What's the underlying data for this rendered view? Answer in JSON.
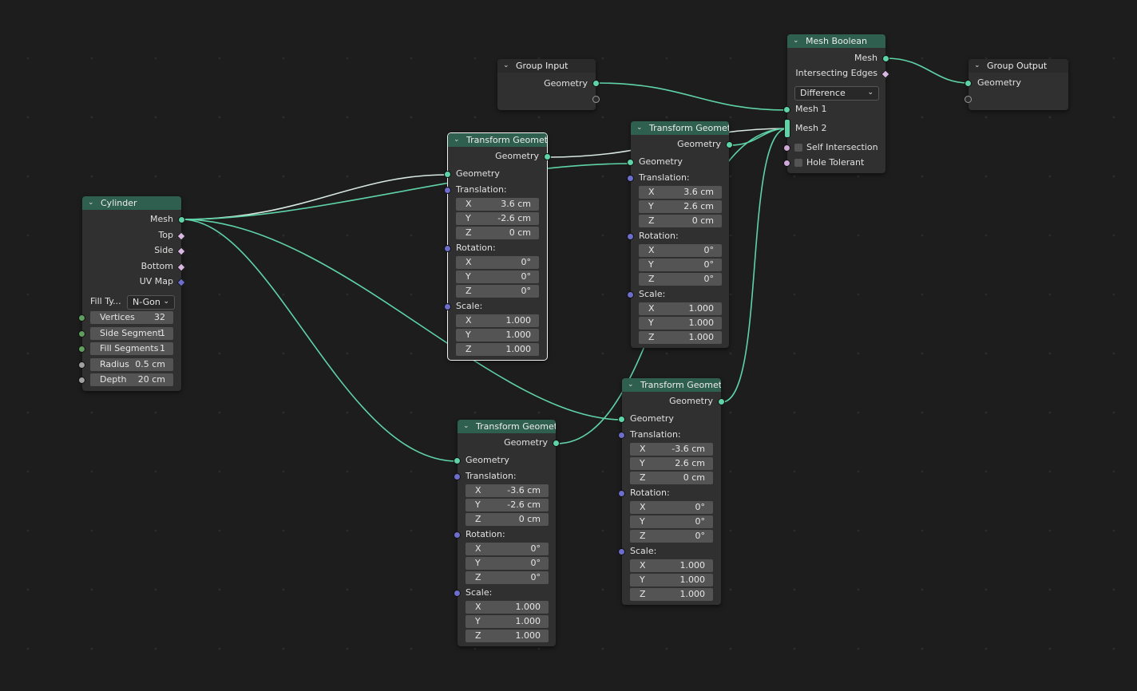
{
  "nodes": {
    "group_input": {
      "title": "Group Input",
      "out_geometry": "Geometry"
    },
    "group_output": {
      "title": "Group Output",
      "in_geometry": "Geometry"
    },
    "mesh_boolean": {
      "title": "Mesh Boolean",
      "out_mesh": "Mesh",
      "out_intersecting_edges": "Intersecting Edges",
      "operation": "Difference",
      "in_mesh1": "Mesh 1",
      "in_mesh2": "Mesh 2",
      "self_intersection": "Self Intersection",
      "hole_tolerant": "Hole Tolerant"
    },
    "cylinder": {
      "title": "Cylinder",
      "out_mesh": "Mesh",
      "out_top": "Top",
      "out_side": "Side",
      "out_bottom": "Bottom",
      "out_uv_map": "UV Map",
      "fill_type_label": "Fill Ty...",
      "fill_type_value": "N-Gon",
      "vertices_label": "Vertices",
      "vertices": "32",
      "side_segments_label": "Side Segment",
      "side_segments": "1",
      "fill_segments_label": "Fill Segments",
      "fill_segments": "1",
      "radius_label": "Radius",
      "radius": "0.5 cm",
      "depth_label": "Depth",
      "depth": "20 cm"
    },
    "transforms": [
      {
        "title": "Transform Geometry",
        "out": "Geometry",
        "in": "Geometry",
        "translation_label": "Translation:",
        "rotation_label": "Rotation:",
        "scale_label": "Scale:",
        "axes": [
          "X",
          "Y",
          "Z"
        ],
        "translation": [
          "3.6 cm",
          "-2.6 cm",
          "0 cm"
        ],
        "rotation": [
          "0°",
          "0°",
          "0°"
        ],
        "scale": [
          "1.000",
          "1.000",
          "1.000"
        ]
      },
      {
        "title": "Transform Geometry",
        "out": "Geometry",
        "in": "Geometry",
        "translation_label": "Translation:",
        "rotation_label": "Rotation:",
        "scale_label": "Scale:",
        "axes": [
          "X",
          "Y",
          "Z"
        ],
        "translation": [
          "3.6 cm",
          "2.6 cm",
          "0 cm"
        ],
        "rotation": [
          "0°",
          "0°",
          "0°"
        ],
        "scale": [
          "1.000",
          "1.000",
          "1.000"
        ]
      },
      {
        "title": "Transform Geometry",
        "out": "Geometry",
        "in": "Geometry",
        "translation_label": "Translation:",
        "rotation_label": "Rotation:",
        "scale_label": "Scale:",
        "axes": [
          "X",
          "Y",
          "Z"
        ],
        "translation": [
          "-3.6 cm",
          "-2.6 cm",
          "0 cm"
        ],
        "rotation": [
          "0°",
          "0°",
          "0°"
        ],
        "scale": [
          "1.000",
          "1.000",
          "1.000"
        ]
      },
      {
        "title": "Transform Geometry",
        "out": "Geometry",
        "in": "Geometry",
        "translation_label": "Translation:",
        "rotation_label": "Rotation:",
        "scale_label": "Scale:",
        "axes": [
          "X",
          "Y",
          "Z"
        ],
        "translation": [
          "-3.6 cm",
          "2.6 cm",
          "0 cm"
        ],
        "rotation": [
          "0°",
          "0°",
          "0°"
        ],
        "scale": [
          "1.000",
          "1.000",
          "1.000"
        ]
      }
    ]
  },
  "colors": {
    "geometry_link": "#5fd3a8",
    "selected_link": "#d8e8e2",
    "node_header": "#2f5f4e",
    "node_body": "#303030",
    "vector_socket": "#6d6dcc",
    "boolean_socket": "#d0a8d8"
  },
  "icons": {
    "collapse": "chevron-down-icon"
  }
}
